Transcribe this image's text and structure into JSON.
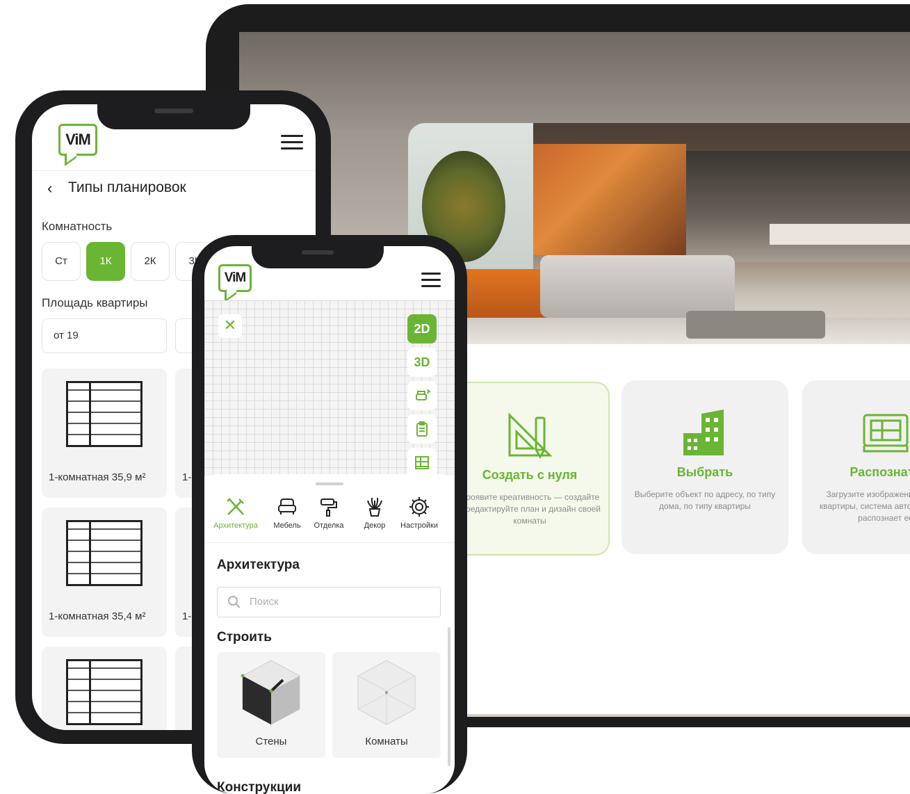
{
  "brand": {
    "logo_text": "ViM",
    "accent": "#6ab534"
  },
  "web": {
    "features": [
      {
        "title": "Создать с нуля",
        "desc": "Проявите креативность — создайте и редактируйте план и дизайн своей комнаты",
        "icon": "ruler-triangle-icon"
      },
      {
        "title": "Выбрать",
        "desc": "Выберите объект по адресу, по типу дома, по типу квартиры",
        "icon": "building-icon"
      },
      {
        "title": "Распознать",
        "desc": "Загрузите изображение вашей квартиры, система автоматически распознает её",
        "icon": "blueprint-icon"
      }
    ]
  },
  "phone1": {
    "back_icon": "‹",
    "title": "Типы планировок",
    "rooms_label": "Комнатность",
    "room_chips": [
      "Ст",
      "1К",
      "2К",
      "3К"
    ],
    "selected_chip": "1К",
    "area_label": "Площадь квартиры",
    "area_from": "от 19",
    "plans": [
      {
        "caption": "1-комнатная 35,9 м²"
      },
      {
        "caption": "1-комнатная 35,4 м²"
      },
      {
        "caption": ""
      }
    ],
    "partial_caption": "1-"
  },
  "phone2": {
    "close_icon": "✕",
    "modes": [
      "2D",
      "3D"
    ],
    "side_icons": [
      "furniture-sparkle-icon",
      "clipboard-icon",
      "blueprint-icon"
    ],
    "tools": [
      {
        "label": "Архитектура",
        "icon": "tools-icon",
        "active": true
      },
      {
        "label": "Мебель",
        "icon": "armchair-icon",
        "active": false
      },
      {
        "label": "Отделка",
        "icon": "paint-roller-icon",
        "active": false
      },
      {
        "label": "Декор",
        "icon": "plant-icon",
        "active": false
      },
      {
        "label": "Настройки",
        "icon": "gear-icon",
        "active": false
      }
    ],
    "section_title": "Архитектура",
    "search_placeholder": "Поиск",
    "build_title": "Строить",
    "build_items": [
      {
        "label": "Стены"
      },
      {
        "label": "Комнаты"
      }
    ],
    "constructions_title": "Конструкции"
  }
}
